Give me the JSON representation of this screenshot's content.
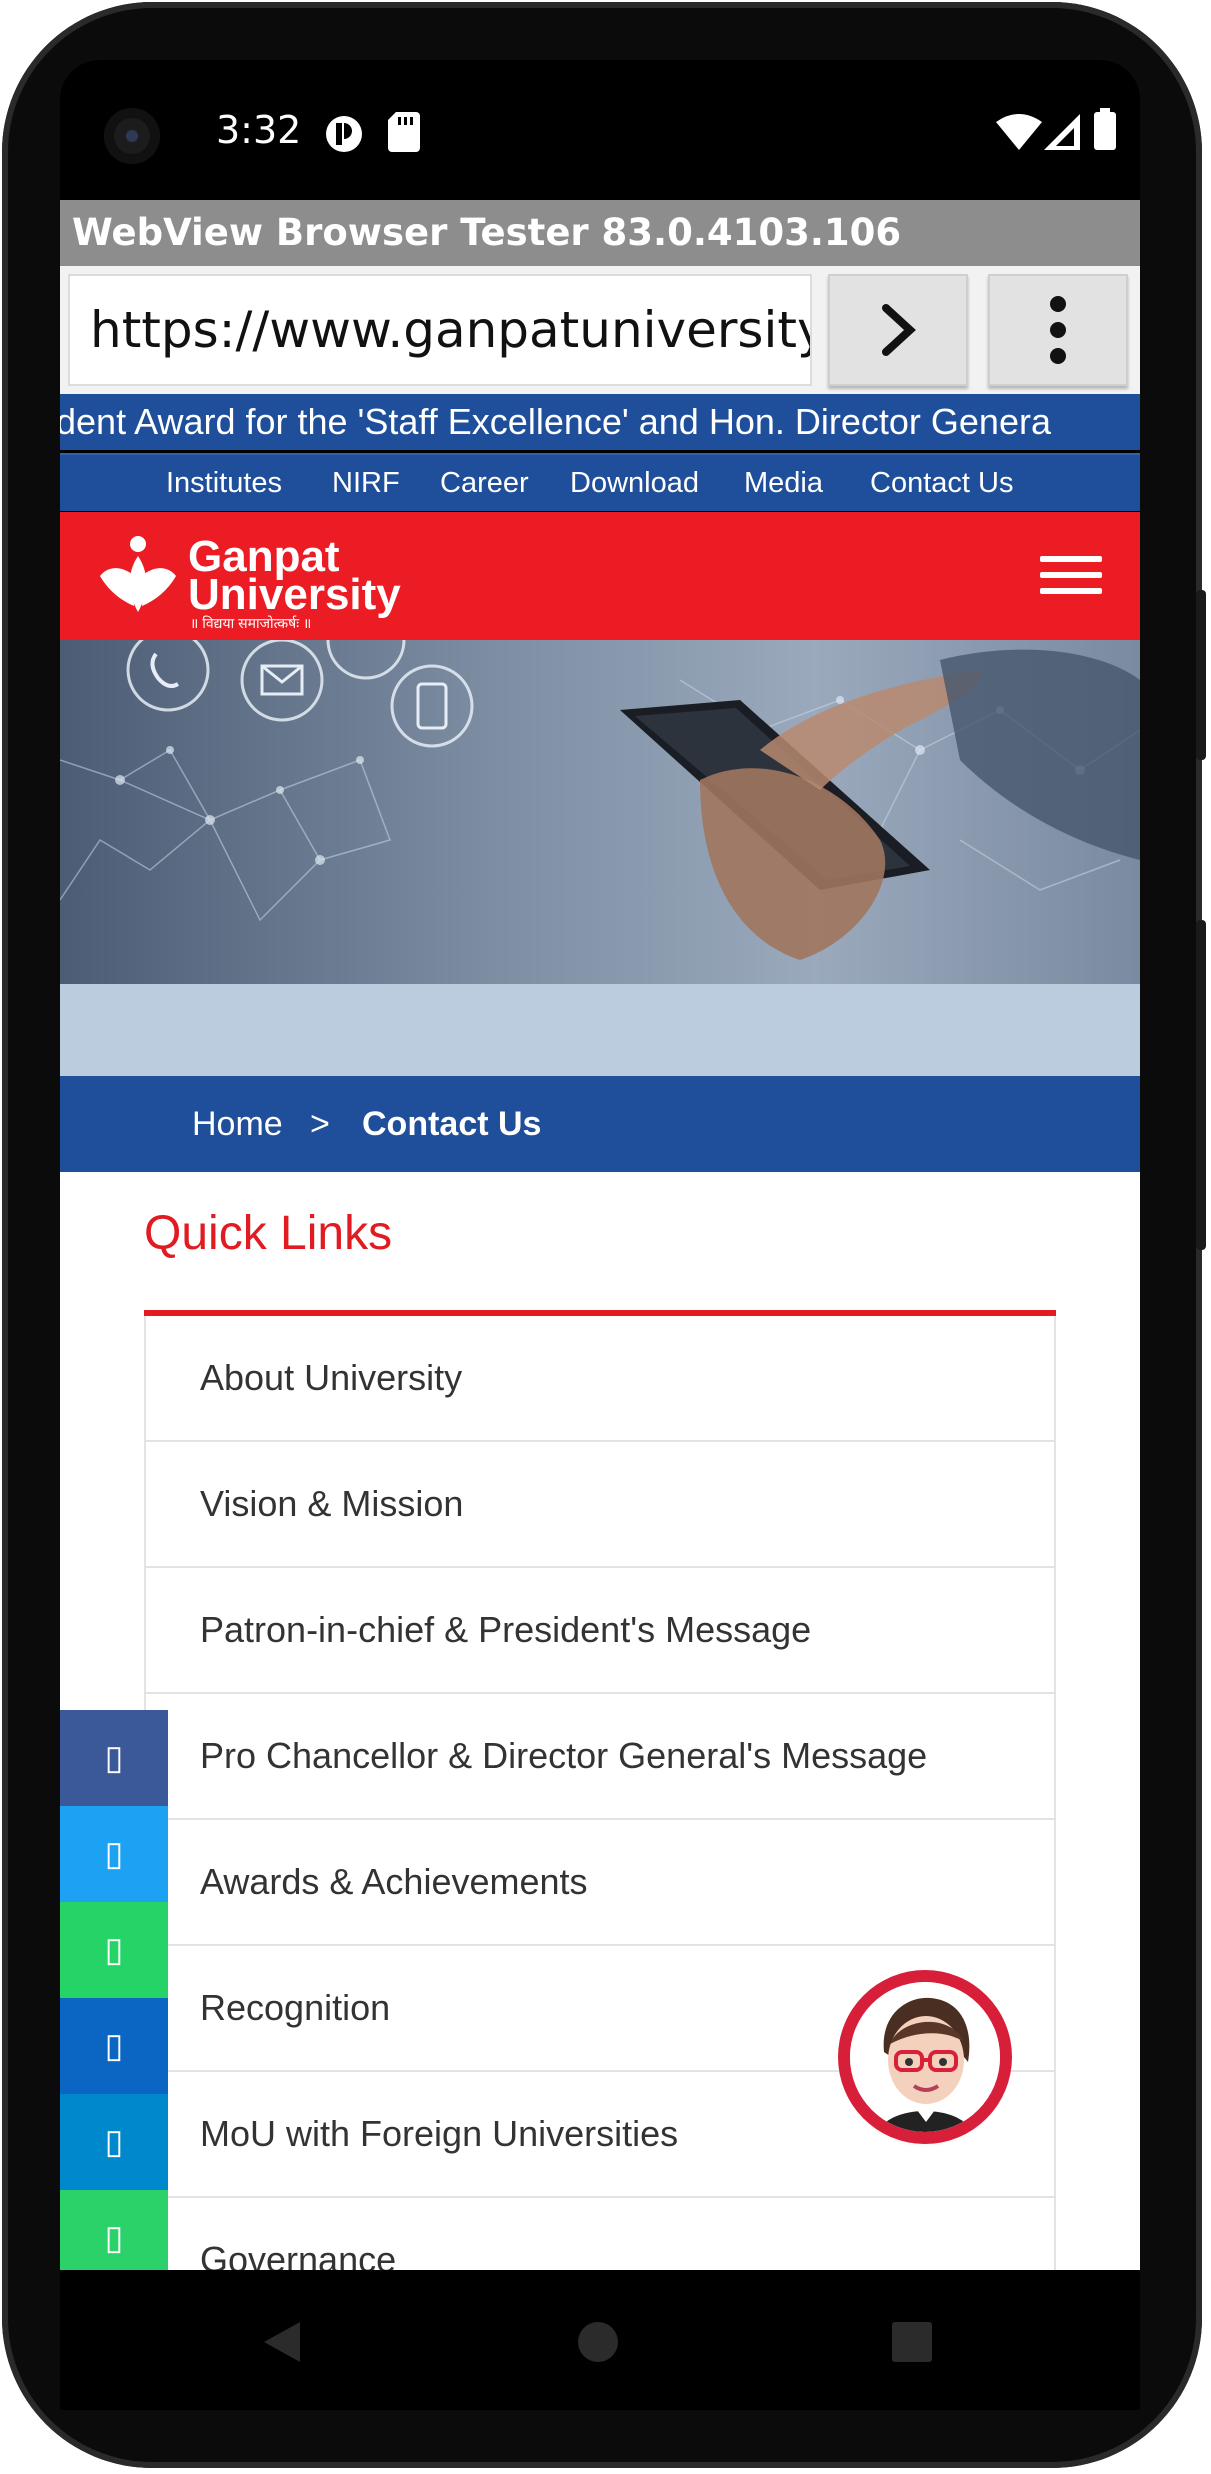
{
  "status_bar": {
    "time": "3:32"
  },
  "browser": {
    "title": "WebView Browser Tester 83.0.4103.106",
    "url": "https://www.ganpatuniversity.ac"
  },
  "site": {
    "ticker": "ident Award for the 'Staff Excellence' and Hon. Director Genera",
    "top_nav": [
      "Institutes",
      "NIRF",
      "Career",
      "Download",
      "Media",
      "Contact Us"
    ],
    "logo": {
      "line1": "Ganpat",
      "line2": "University",
      "tagline": "॥ विद्यया समाजोत्कर्षः ॥"
    },
    "breadcrumb": {
      "home": "Home",
      "separator": ">",
      "current": "Contact Us"
    },
    "quick_links": {
      "title": "Quick Links",
      "items": [
        "About University",
        "Vision & Mission",
        "Patron-in-chief & President's Message",
        "Pro Chancellor & Director General's Message",
        "Awards & Achievements",
        "Recognition",
        "MoU with Foreign Universities",
        "Governance"
      ]
    },
    "share_icons": [
      {
        "icon": "facebook-icon",
        "color": "#3b5998",
        "glyph": "▯"
      },
      {
        "icon": "twitter-icon",
        "color": "#1da1f2",
        "glyph": "▯"
      },
      {
        "icon": "whatsapp-icon",
        "color": "#25d366",
        "glyph": "▯"
      },
      {
        "icon": "linkedin-icon",
        "color": "#0a66c2",
        "glyph": "▯"
      },
      {
        "icon": "telegram-icon",
        "color": "#0088cc",
        "glyph": "▯"
      },
      {
        "icon": "sms-icon",
        "color": "#2bd26a",
        "glyph": "▯"
      }
    ]
  },
  "colors": {
    "brand_red": "#ec1c24",
    "brand_blue": "#1f4f9a"
  }
}
